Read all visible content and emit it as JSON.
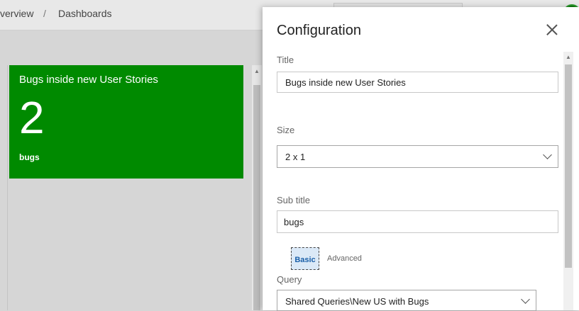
{
  "breadcrumb": {
    "overview": "verview",
    "separator": "/",
    "dashboards": "Dashboards"
  },
  "tile": {
    "title": "Bugs inside new User Stories",
    "count": "2",
    "subtitle": "bugs",
    "color": "#008a00"
  },
  "config": {
    "title": "Configuration",
    "title_label": "Title",
    "title_value": "Bugs inside new User Stories",
    "size_label": "Size",
    "size_value": "2 x 1",
    "subtitle_label": "Sub title",
    "subtitle_value": "bugs",
    "tabs": {
      "basic": "Basic",
      "advanced": "Advanced"
    },
    "query_label": "Query",
    "query_value": "Shared Queries\\New US with Bugs"
  }
}
